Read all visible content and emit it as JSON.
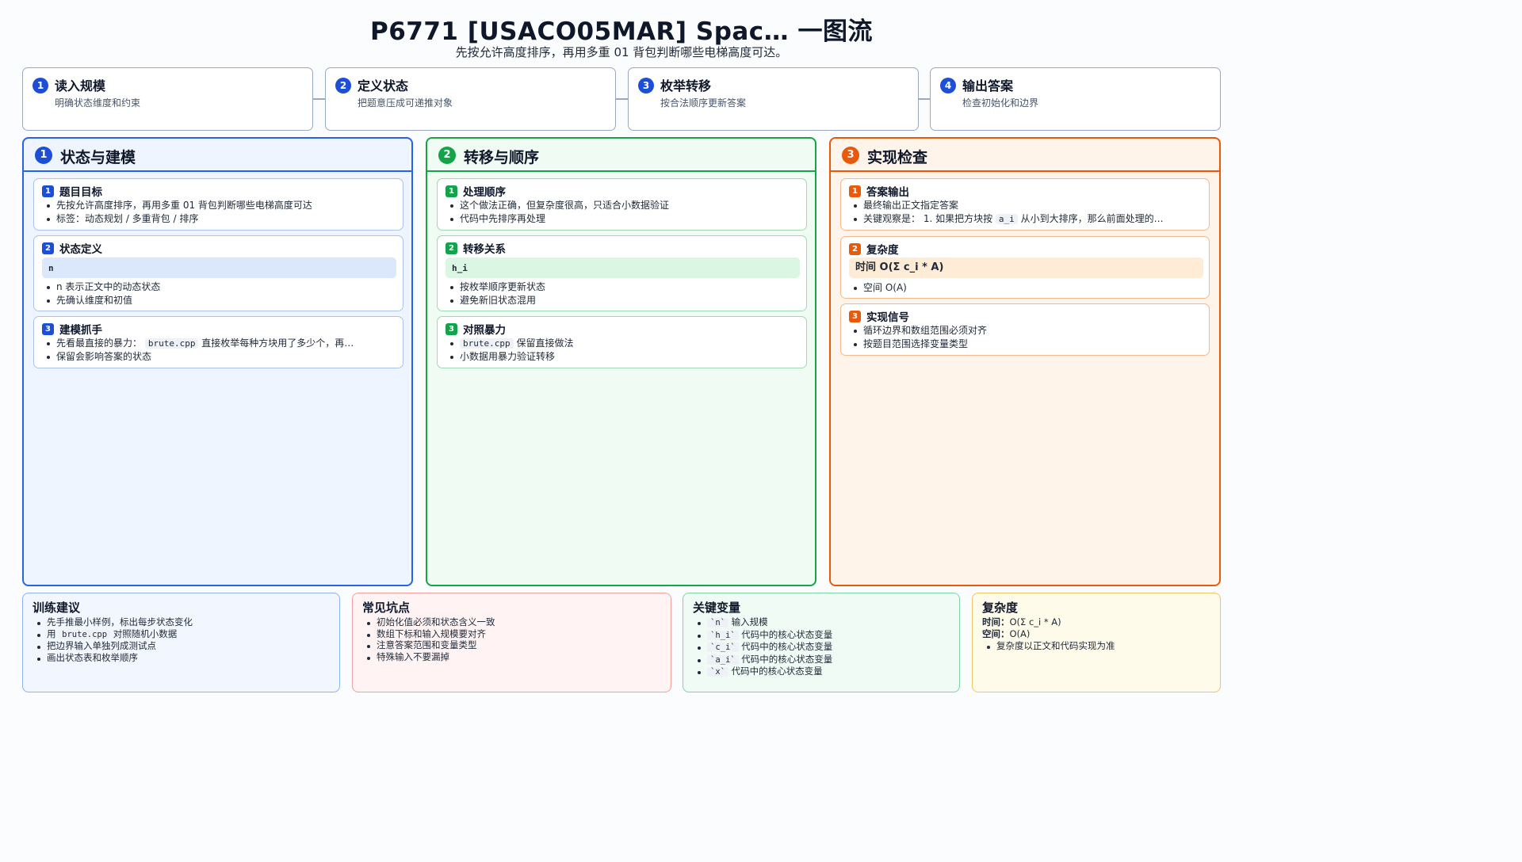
{
  "header": {
    "title": "P6771 [USACO05MAR] Spac… 一图流",
    "subtitle": "先按允许高度排序，再用多重 01 背包判断哪些电梯高度可达。"
  },
  "steps": [
    {
      "num": "1",
      "title": "读入规模",
      "desc": "明确状态维度和约束"
    },
    {
      "num": "2",
      "title": "定义状态",
      "desc": "把题意压成可递推对象"
    },
    {
      "num": "3",
      "title": "枚举转移",
      "desc": "按合法顺序更新答案"
    },
    {
      "num": "4",
      "title": "输出答案",
      "desc": "检查初始化和边界"
    }
  ],
  "columns": {
    "model": {
      "num": "1",
      "title": "状态与建模",
      "cards": [
        {
          "num": "1",
          "title": "题目目标",
          "items": [
            "先按允许高度排序，再用多重 01 背包判断哪些电梯高度可达",
            "标签：动态规划 / 多重背包 / 排序"
          ]
        },
        {
          "num": "2",
          "title": "状态定义",
          "formula": "n",
          "items": [
            "n 表示正文中的动态状态",
            "先确认维度和初值"
          ]
        },
        {
          "num": "3",
          "title": "建模抓手",
          "item1_pre": "先看最直接的暴力：",
          "item1_code": "brute.cpp",
          "item1_post": "直接枚举每种方块用了多少个，再…",
          "item2": "保留会影响答案的状态"
        }
      ]
    },
    "transition": {
      "num": "2",
      "title": "转移与顺序",
      "cards": [
        {
          "num": "1",
          "title": "处理顺序",
          "items": [
            "这个做法正确，但复杂度很高，只适合小数据验证",
            "代码中先排序再处理"
          ]
        },
        {
          "num": "2",
          "title": "转移关系",
          "formula": "h_i",
          "items": [
            "按枚举顺序更新状态",
            "避免新旧状态混用"
          ]
        },
        {
          "num": "3",
          "title": "对照暴力",
          "item1_code": "brute.cpp",
          "item1_post": "保留直接做法",
          "item2": "小数据用暴力验证转移"
        }
      ]
    },
    "check": {
      "num": "3",
      "title": "实现检查",
      "cards": [
        {
          "num": "1",
          "title": "答案输出",
          "item1": "最终输出正文指定答案",
          "item2_pre": "关键观察是：  1. 如果把方块按",
          "item2_code": "a_i",
          "item2_post": "从小到大排序，那么前面处理的…"
        },
        {
          "num": "2",
          "title": "复杂度",
          "formula": "时间 O(Σ c_i * A)",
          "items": [
            "空间 O(A)"
          ]
        },
        {
          "num": "3",
          "title": "实现信号",
          "items": [
            "循环边界和数组范围必须对齐",
            "按题目范围选择变量类型"
          ]
        }
      ]
    }
  },
  "bottom": {
    "training": {
      "title": "训练建议",
      "item1": "先手推最小样例，标出每步状态变化",
      "item2_pre": "用",
      "item2_code": "brute.cpp",
      "item2_post": "对照随机小数据",
      "item3": "把边界输入单独列成测试点",
      "item4": "画出状态表和枚举顺序"
    },
    "pitfalls": {
      "title": "常见坑点",
      "items": [
        "初始化值必须和状态含义一致",
        "数组下标和输入规模要对齐",
        "注意答案范围和变量类型",
        "特殊输入不要漏掉"
      ]
    },
    "variables": {
      "title": "关键变量",
      "rows": [
        {
          "code": "`n`",
          "text": "输入规模"
        },
        {
          "code": "`h_i`",
          "text": "代码中的核心状态变量"
        },
        {
          "code": "`c_i`",
          "text": "代码中的核心状态变量"
        },
        {
          "code": "`a_i`",
          "text": "代码中的核心状态变量"
        },
        {
          "code": "`x`",
          "text": "代码中的核心状态变量"
        }
      ]
    },
    "complexity": {
      "title": "复杂度",
      "time_label": "时间：",
      "time_value": "O(Σ c_i * A)",
      "space_label": "空间：",
      "space_value": "O(A)",
      "note": "复杂度以正文和代码实现为准"
    }
  },
  "colors": {
    "blue": "#2563eb",
    "green": "#16a34a",
    "orange": "#ea580c"
  }
}
